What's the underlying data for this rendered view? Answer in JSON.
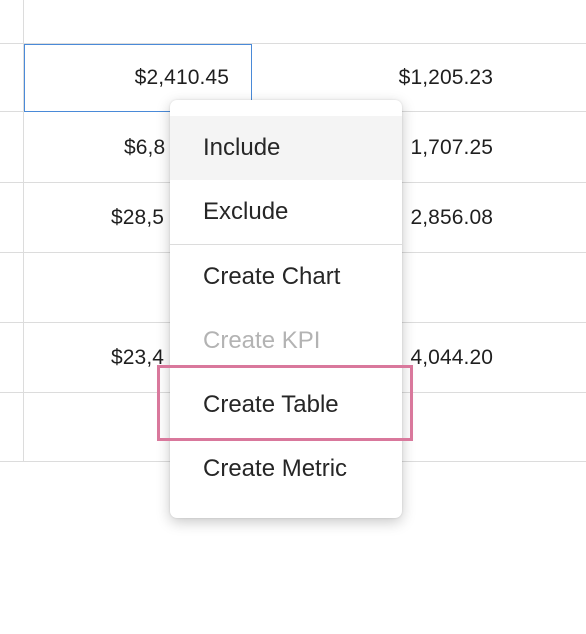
{
  "sheet": {
    "rows": [
      {
        "col1": "$2,410.45",
        "col2": "$1,205.23"
      },
      {
        "col1": "$6,8",
        "col2": "1,707.25"
      },
      {
        "col1": "$28,5",
        "col2": "2,856.08"
      },
      {
        "col1": "",
        "col2": ""
      },
      {
        "col1": "$23,4",
        "col2": "4,044.20"
      },
      {
        "col1": "",
        "col2": ""
      }
    ]
  },
  "context_menu": {
    "items": [
      {
        "label": "Include"
      },
      {
        "label": "Exclude"
      },
      {
        "label": "Create Chart"
      },
      {
        "label": "Create KPI"
      },
      {
        "label": "Create Table"
      },
      {
        "label": "Create Metric"
      }
    ],
    "hovered_item": "Include",
    "disabled_item": "Create KPI",
    "highlighted_item": "Create Table"
  },
  "colors": {
    "selection_border": "#4a8ad8",
    "highlight_box": "#d9789c",
    "disabled_text": "#b3b3b3"
  }
}
